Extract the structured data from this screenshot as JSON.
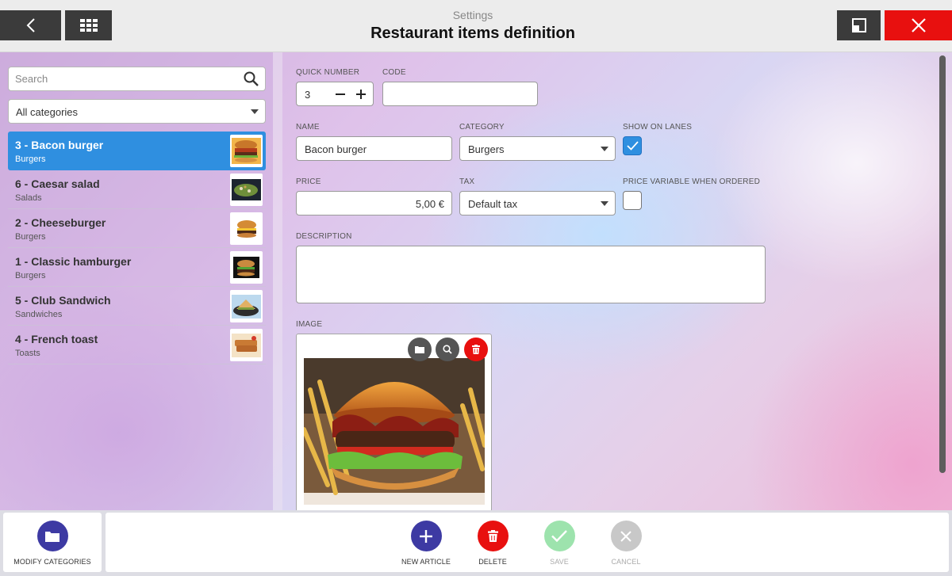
{
  "header": {
    "subtitle": "Settings",
    "title": "Restaurant items definition"
  },
  "sidebar": {
    "search_placeholder": "Search",
    "category_filter": "All categories",
    "items": [
      {
        "label": "3 - Bacon burger",
        "category": "Burgers",
        "selected": true
      },
      {
        "label": "6 - Caesar salad",
        "category": "Salads",
        "selected": false
      },
      {
        "label": "2 - Cheeseburger",
        "category": "Burgers",
        "selected": false
      },
      {
        "label": "1 - Classic hamburger",
        "category": "Burgers",
        "selected": false
      },
      {
        "label": "5 - Club Sandwich",
        "category": "Sandwiches",
        "selected": false
      },
      {
        "label": "4 - French toast",
        "category": "Toasts",
        "selected": false
      }
    ]
  },
  "form": {
    "quick_number_label": "QUICK NUMBER",
    "quick_number_value": "3",
    "code_label": "CODE",
    "code_value": "",
    "name_label": "NAME",
    "name_value": "Bacon burger",
    "category_label": "CATEGORY",
    "category_value": "Burgers",
    "show_on_lanes_label": "SHOW ON LANES",
    "show_on_lanes_checked": true,
    "price_label": "PRICE",
    "price_value": "5,00 €",
    "tax_label": "TAX",
    "tax_value": "Default tax",
    "price_variable_label": "PRICE VARIABLE WHEN ORDERED",
    "price_variable_checked": false,
    "description_label": "DESCRIPTION",
    "description_value": "",
    "image_label": "IMAGE"
  },
  "footer": {
    "modify_categories": "MODIFY CATEGORIES",
    "new_article": "NEW ARTICLE",
    "delete": "DELETE",
    "save": "SAVE",
    "cancel": "CANCEL"
  },
  "colors": {
    "accent_blue": "#2f8fe0",
    "primary_purple": "#3d3aa3",
    "danger_red": "#e8100f",
    "success_green_disabled": "#9de3ad",
    "cancel_gray_disabled": "#c8c8c8"
  },
  "icons": [
    "back-icon",
    "grid-icon",
    "restore-window-icon",
    "close-icon",
    "search-icon",
    "folder-icon",
    "zoom-icon",
    "trash-icon",
    "plus-icon",
    "check-icon",
    "x-icon"
  ]
}
